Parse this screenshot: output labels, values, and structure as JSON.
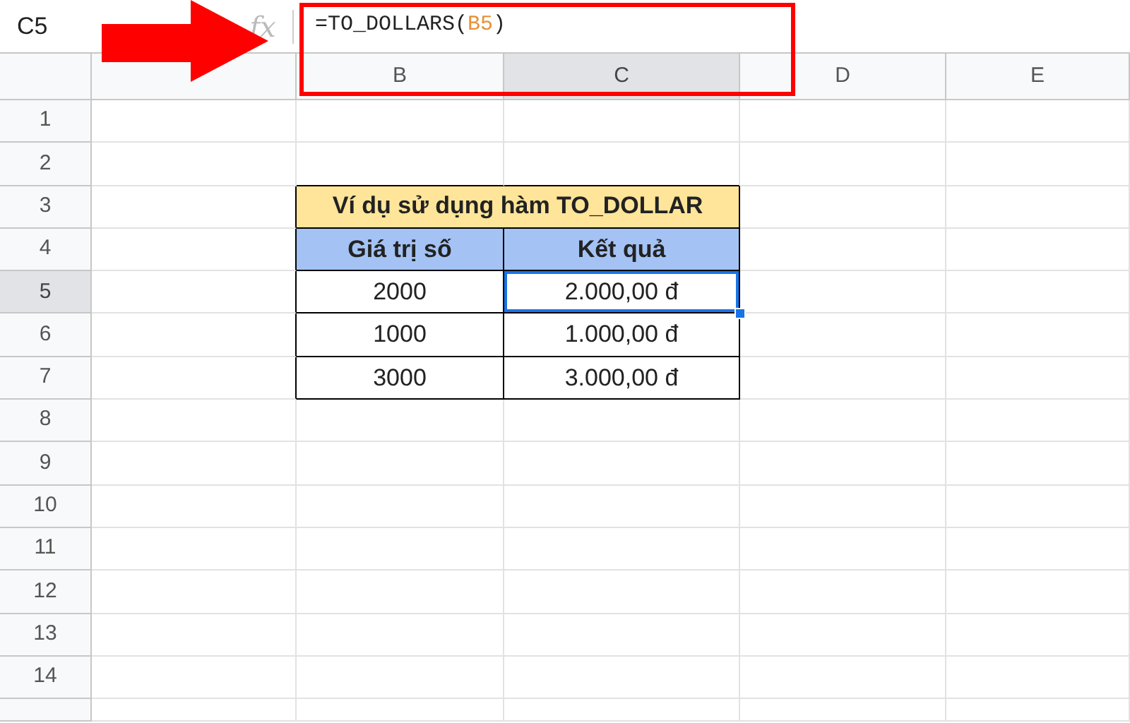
{
  "name_box": "C5",
  "fx_label": "fx",
  "formula": [
    {
      "text": "=TO_DOLLARS(",
      "kind": "plain"
    },
    {
      "text": "B5",
      "kind": "ref"
    },
    {
      "text": ")",
      "kind": "plain"
    }
  ],
  "columns": [
    {
      "label": "B",
      "selected": false
    },
    {
      "label": "C",
      "selected": true
    },
    {
      "label": "D",
      "selected": false
    },
    {
      "label": "E",
      "selected": false
    }
  ],
  "rows": [
    {
      "label": "1",
      "selected": false
    },
    {
      "label": "2",
      "selected": false
    },
    {
      "label": "3",
      "selected": false
    },
    {
      "label": "4",
      "selected": false
    },
    {
      "label": "5",
      "selected": true
    },
    {
      "label": "6",
      "selected": false
    },
    {
      "label": "7",
      "selected": false
    },
    {
      "label": "8",
      "selected": false
    },
    {
      "label": "9",
      "selected": false
    },
    {
      "label": "10",
      "selected": false
    },
    {
      "label": "11",
      "selected": false
    },
    {
      "label": "12",
      "selected": false
    },
    {
      "label": "13",
      "selected": false
    },
    {
      "label": "14",
      "selected": false
    }
  ],
  "table": {
    "title": "Ví dụ sử dụng hàm TO_DOLLAR",
    "headers": [
      "Giá trị số",
      "Kết quả"
    ],
    "rows": [
      {
        "cells": [
          {
            "text": "2000",
            "selected": false
          },
          {
            "text": "2.000,00 đ",
            "selected": true
          }
        ]
      },
      {
        "cells": [
          {
            "text": "1000",
            "selected": false
          },
          {
            "text": "1.000,00 đ",
            "selected": false
          }
        ]
      },
      {
        "cells": [
          {
            "text": "3000",
            "selected": false
          },
          {
            "text": "3.000,00 đ",
            "selected": false
          }
        ]
      }
    ]
  }
}
